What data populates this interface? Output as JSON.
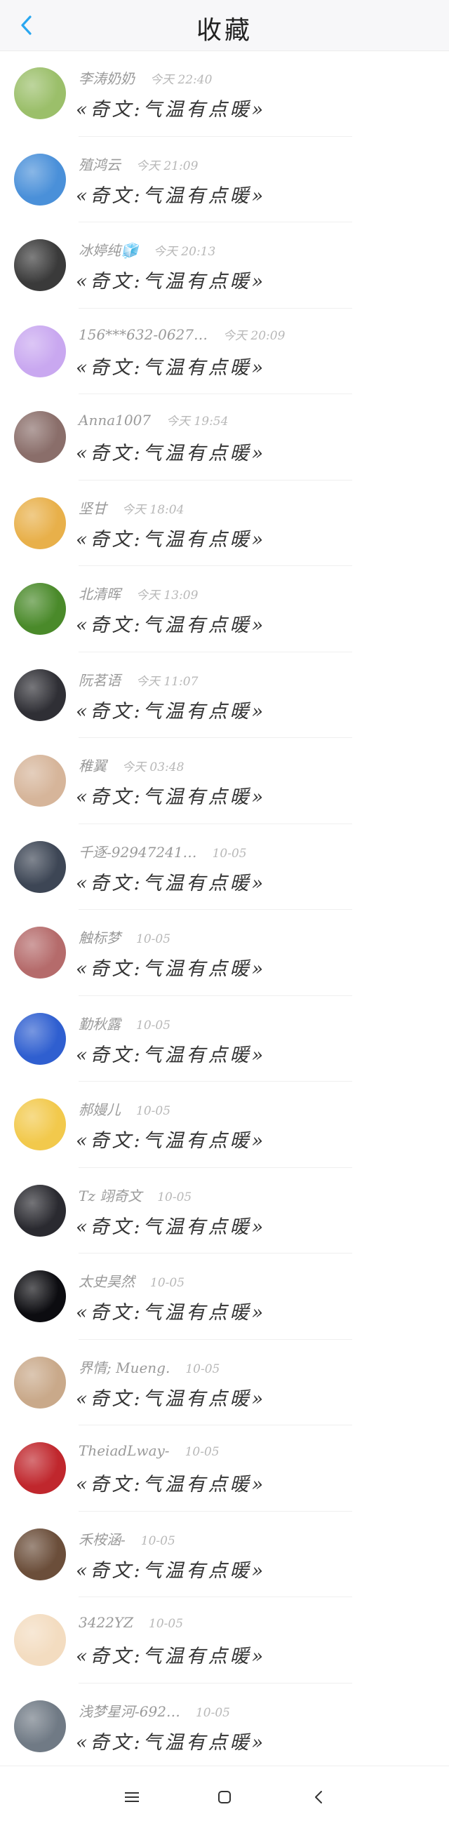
{
  "header": {
    "title": "收藏",
    "back_icon": "chevron-left-icon"
  },
  "accent_color": "#2aa7f0",
  "items": [
    {
      "name": "李涛奶奶",
      "time": "今天 22:40",
      "message": "«奇文:气温有点暖»",
      "avatar_color": "#9bbf6a"
    },
    {
      "name": "殖鸿云",
      "time": "今天 21:09",
      "message": "«奇文:气温有点暖»",
      "avatar_color": "#4a90d9"
    },
    {
      "name": "冰婷纯🧊",
      "time": "今天 20:13",
      "message": "«奇文:气温有点暖»",
      "avatar_color": "#3a3a3a"
    },
    {
      "name": "156***632-0627…",
      "time": "今天 20:09",
      "message": "«奇文:气温有点暖»",
      "avatar_color": "#c9a8f0"
    },
    {
      "name": "Anna1007",
      "time": "今天 19:54",
      "message": "«奇文:气温有点暖»",
      "avatar_color": "#8a6e6a"
    },
    {
      "name": "坚甘",
      "time": "今天 18:04",
      "message": "«奇文:气温有点暖»",
      "avatar_color": "#e8b04a"
    },
    {
      "name": "北清晖",
      "time": "今天 13:09",
      "message": "«奇文:气温有点暖»",
      "avatar_color": "#4a8a2a"
    },
    {
      "name": "阮茗语",
      "time": "今天 11:07",
      "message": "«奇文:气温有点暖»",
      "avatar_color": "#2f2f35"
    },
    {
      "name": "稚翼",
      "time": "今天 03:48",
      "message": "«奇文:气温有点暖»",
      "avatar_color": "#d6b59a"
    },
    {
      "name": "千逐-92947241…",
      "time": "10-05",
      "message": "«奇文:气温有点暖»",
      "avatar_color": "#3d4655"
    },
    {
      "name": "触标梦",
      "time": "10-05",
      "message": "«奇文:气温有点暖»",
      "avatar_color": "#b56b6b"
    },
    {
      "name": "勤秋露",
      "time": "10-05",
      "message": "«奇文:气温有点暖»",
      "avatar_color": "#2f5fd0"
    },
    {
      "name": "郝嫚儿",
      "time": "10-05",
      "message": "«奇文:气温有点暖»",
      "avatar_color": "#f2c94c"
    },
    {
      "name": "Tz 翊奇文",
      "time": "10-05",
      "message": "«奇文:气温有点暖»",
      "avatar_color": "#2a2a30"
    },
    {
      "name": "太史昊然",
      "time": "10-05",
      "message": "«奇文:气温有点暖»",
      "avatar_color": "#0c0c10"
    },
    {
      "name": "界情; Mueng.",
      "time": "10-05",
      "message": "«奇文:气温有点暖»",
      "avatar_color": "#c9a98a"
    },
    {
      "name": "TheiadLway-",
      "time": "10-05",
      "message": "«奇文:气温有点暖»",
      "avatar_color": "#c0272d"
    },
    {
      "name": "禾桉涵-",
      "time": "10-05",
      "message": "«奇文:气温有点暖»",
      "avatar_color": "#6b4e3a"
    },
    {
      "name": "3422YZ",
      "time": "10-05",
      "message": "«奇文:气温有点暖»",
      "avatar_color": "#f3dcc0"
    },
    {
      "name": "浅梦星河-692…",
      "time": "10-05",
      "message": "«奇文:气温有点暖»",
      "avatar_color": "#707a85"
    }
  ],
  "navbar": {
    "menu_icon": "menu-icon",
    "home_icon": "home-square-icon",
    "back_icon": "back-triangle-icon"
  }
}
